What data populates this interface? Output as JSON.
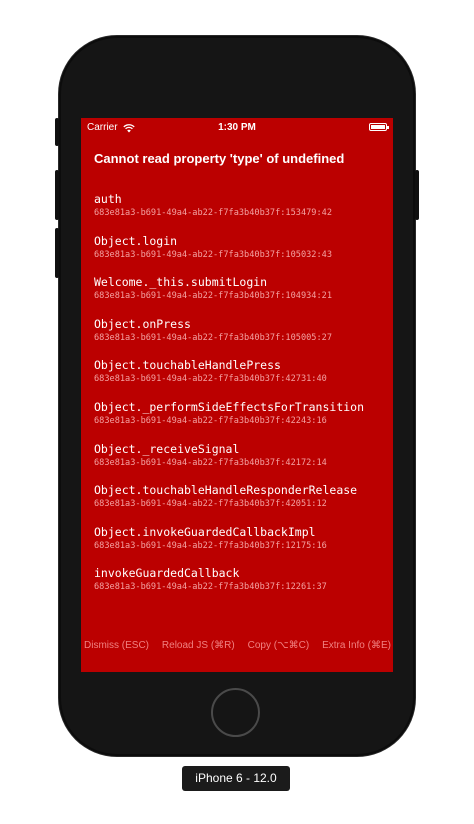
{
  "status_bar": {
    "carrier": "Carrier",
    "time": "1:30 PM",
    "wifi_icon": "wifi-icon",
    "battery_icon": "battery-icon"
  },
  "error": {
    "title": "Cannot read property 'type' of undefined"
  },
  "stack": [
    {
      "method": "auth",
      "location": "683e81a3-b691-49a4-ab22-f7fa3b40b37f:153479:42"
    },
    {
      "method": "Object.login",
      "location": "683e81a3-b691-49a4-ab22-f7fa3b40b37f:105032:43"
    },
    {
      "method": "Welcome._this.submitLogin",
      "location": "683e81a3-b691-49a4-ab22-f7fa3b40b37f:104934:21"
    },
    {
      "method": "Object.onPress",
      "location": "683e81a3-b691-49a4-ab22-f7fa3b40b37f:105005:27"
    },
    {
      "method": "Object.touchableHandlePress",
      "location": "683e81a3-b691-49a4-ab22-f7fa3b40b37f:42731:40"
    },
    {
      "method": "Object._performSideEffectsForTransition",
      "location": "683e81a3-b691-49a4-ab22-f7fa3b40b37f:42243:16"
    },
    {
      "method": "Object._receiveSignal",
      "location": "683e81a3-b691-49a4-ab22-f7fa3b40b37f:42172:14"
    },
    {
      "method": "Object.touchableHandleResponderRelease",
      "location": "683e81a3-b691-49a4-ab22-f7fa3b40b37f:42051:12"
    },
    {
      "method": "Object.invokeGuardedCallbackImpl",
      "location": "683e81a3-b691-49a4-ab22-f7fa3b40b37f:12175:16"
    },
    {
      "method": "invokeGuardedCallback",
      "location": "683e81a3-b691-49a4-ab22-f7fa3b40b37f:12261:37"
    }
  ],
  "toolbar": {
    "dismiss": "Dismiss (ESC)",
    "reload": "Reload JS (⌘R)",
    "copy": "Copy (⌥⌘C)",
    "extra_info": "Extra Info (⌘E)"
  },
  "device": {
    "label": "iPhone 6 - 12.0"
  },
  "colors": {
    "redbox_background": "#bb0000",
    "stack_location_text": "#f3a1a1",
    "toolbar_text": "#f08080",
    "device_frame": "#151515"
  }
}
